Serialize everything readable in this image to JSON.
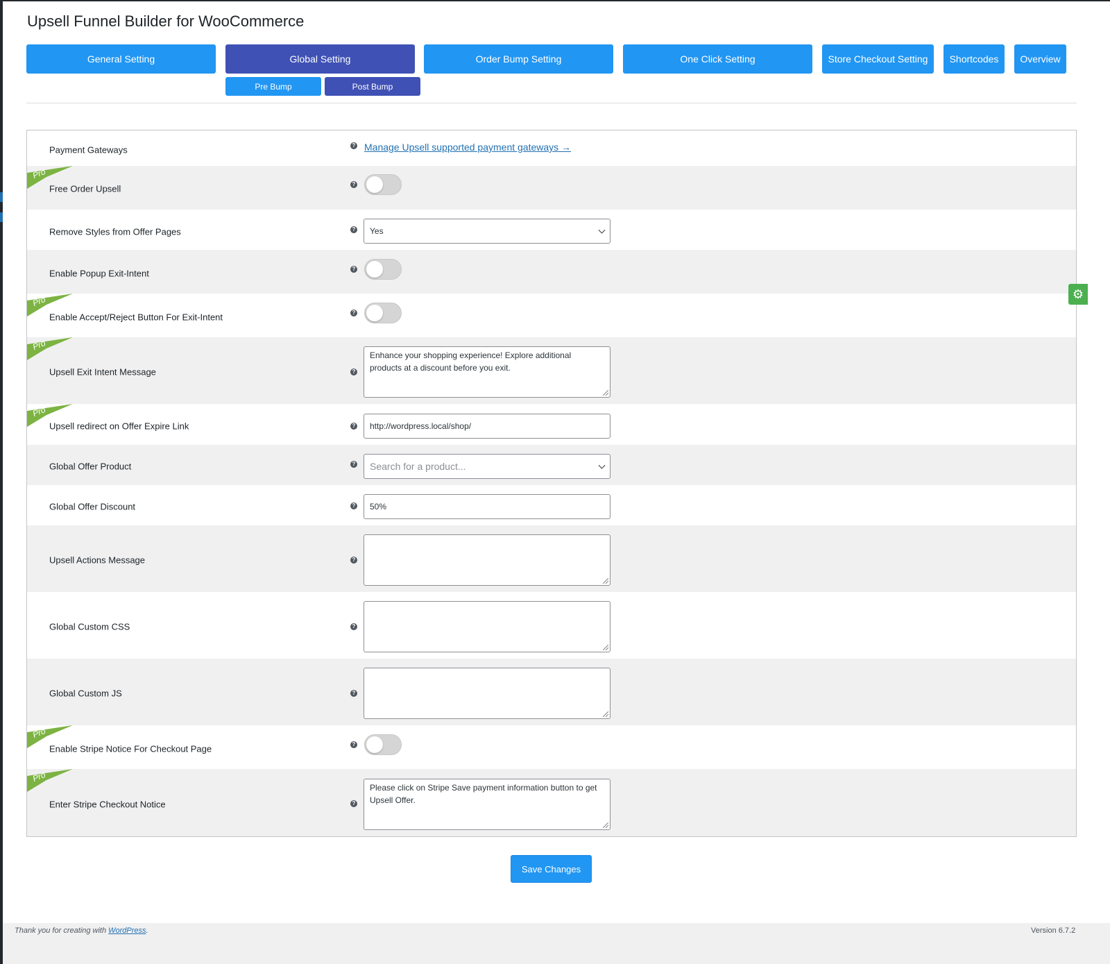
{
  "page": {
    "title": "Upsell Funnel Builder for WooCommerce"
  },
  "tabs": [
    {
      "label": "General Setting",
      "active": false
    },
    {
      "label": "Global Setting",
      "active": true
    },
    {
      "label": "Order Bump Setting",
      "active": false
    },
    {
      "label": "One Click Setting",
      "active": false
    },
    {
      "label": "Store Checkout Setting",
      "active": false
    },
    {
      "label": "Shortcodes",
      "active": false
    },
    {
      "label": "Overview",
      "active": false
    }
  ],
  "subtabs": [
    {
      "label": "Pre Bump",
      "active": false
    },
    {
      "label": "Post Bump",
      "active": true
    }
  ],
  "badges": {
    "pro": "Pro"
  },
  "help_glyph": "?",
  "settings": {
    "payment_gateways": {
      "label": "Payment Gateways",
      "link": "Manage Upsell supported payment gateways →"
    },
    "free_order_upsell": {
      "label": "Free Order Upsell",
      "enabled": false,
      "pro": true
    },
    "remove_styles": {
      "label": "Remove Styles from Offer Pages",
      "value": "Yes"
    },
    "popup_exit_intent": {
      "label": "Enable Popup Exit-Intent",
      "enabled": false
    },
    "accept_reject_exit_intent": {
      "label": "Enable Accept/Reject Button For Exit-Intent",
      "enabled": false,
      "pro": true
    },
    "exit_intent_message": {
      "label": "Upsell Exit Intent Message",
      "value": "Enhance your shopping experience! Explore additional products at a discount before you exit.",
      "pro": true
    },
    "offer_expire_link": {
      "label": "Upsell redirect on Offer Expire Link",
      "value": "http://wordpress.local/shop/",
      "pro": true
    },
    "global_offer_product": {
      "label": "Global Offer Product",
      "placeholder": "Search for a product..."
    },
    "global_offer_discount": {
      "label": "Global Offer Discount",
      "value": "50%"
    },
    "upsell_actions_message": {
      "label": "Upsell Actions Message",
      "value": ""
    },
    "global_custom_css": {
      "label": "Global Custom CSS",
      "value": ""
    },
    "global_custom_js": {
      "label": "Global Custom JS",
      "value": ""
    },
    "stripe_notice": {
      "label": "Enable Stripe Notice For Checkout Page",
      "enabled": false,
      "pro": true
    },
    "stripe_checkout_notice": {
      "label": "Enter Stripe Checkout Notice",
      "value": "Please click on Stripe Save payment information button to get Upsell Offer.",
      "pro": true
    }
  },
  "actions": {
    "save_label": "Save Changes"
  },
  "footer": {
    "thanks_prefix": "Thank you for creating with",
    "wp_link": "WordPress",
    "thanks_suffix": ".",
    "version": "Version 6.7.2"
  },
  "colors": {
    "tab": "#2196f3",
    "tab_active": "#3f51b5",
    "pro_badge": "#7cb342",
    "gear_tab": "#4caf50",
    "link": "#2271b1"
  }
}
